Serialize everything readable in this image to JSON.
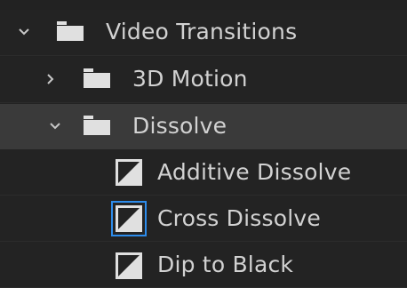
{
  "tree": {
    "root": {
      "label": "Video Transitions",
      "expanded": true
    },
    "children": [
      {
        "label": "3D Motion",
        "expanded": false
      },
      {
        "label": "Dissolve",
        "expanded": true,
        "highlighted": true,
        "items": [
          {
            "label": "Additive Dissolve",
            "selected": false
          },
          {
            "label": "Cross Dissolve",
            "selected": true
          },
          {
            "label": "Dip to Black",
            "selected": false
          }
        ]
      }
    ]
  },
  "colors": {
    "background": "#222222",
    "highlight_row": "#3a3a3a",
    "text": "#d2d2d2",
    "icon": "#e0e0e0",
    "selection_outline": "#2d8ceb"
  },
  "icons": {
    "expanded": "chevron-down-icon",
    "collapsed": "chevron-right-icon",
    "bin": "folder-icon",
    "transition": "transition-preset-icon"
  }
}
